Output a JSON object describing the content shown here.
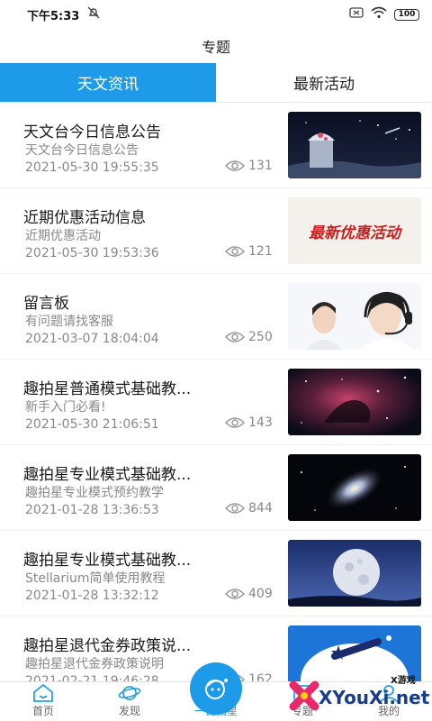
{
  "status": {
    "time": "下午5:33",
    "battery": "100"
  },
  "title": "专题",
  "tabs": [
    {
      "label": "天文资讯",
      "active": true
    },
    {
      "label": "最新活动",
      "active": false
    }
  ],
  "items": [
    {
      "title": "天文台今日信息公告",
      "subtitle": "天文台今日信息公告",
      "date": "2021-05-30 19:55:35",
      "views": "131",
      "thumb": "observatory"
    },
    {
      "title": "近期优惠活动信息",
      "subtitle": "近期优惠活动",
      "date": "2021-05-30 19:53:36",
      "views": "121",
      "thumb": "promo"
    },
    {
      "title": "留言板",
      "subtitle": "有问题请找客服",
      "date": "2021-03-07 18:04:04",
      "views": "250",
      "thumb": "customer-service"
    },
    {
      "title": "趣拍星普通模式基础教...",
      "subtitle": "新手入门必看!",
      "date": "2021-05-30 21:06:51",
      "views": "143",
      "thumb": "nebula"
    },
    {
      "title": "趣拍星专业模式基础教...",
      "subtitle": "趣拍星专业模式预约教学",
      "date": "2021-01-28 13:36:53",
      "views": "844",
      "thumb": "galaxy"
    },
    {
      "title": "趣拍星专业模式基础教...",
      "subtitle": "Stellarium简单使用教程",
      "date": "2021-01-28 13:32:12",
      "views": "409",
      "thumb": "moon"
    },
    {
      "title": "趣拍星退代金券政策说...",
      "subtitle": "趣拍星退代金券政策说明",
      "date": "2021-02-21 19:46:28",
      "views": "162",
      "thumb": "app-logo"
    }
  ],
  "promo_text": "最新优惠活动",
  "nav": [
    {
      "label": "首页",
      "icon": "home-icon"
    },
    {
      "label": "发现",
      "icon": "planet-icon"
    },
    {
      "label": "一键拍星",
      "icon": "capture-icon"
    },
    {
      "label": "专题",
      "icon": "topic-icon"
    },
    {
      "label": "我的",
      "icon": "profile-icon"
    }
  ],
  "watermark": {
    "brand": "XYouXi.net",
    "tag": "X游戏"
  },
  "colors": {
    "accent": "#1e9be8"
  }
}
